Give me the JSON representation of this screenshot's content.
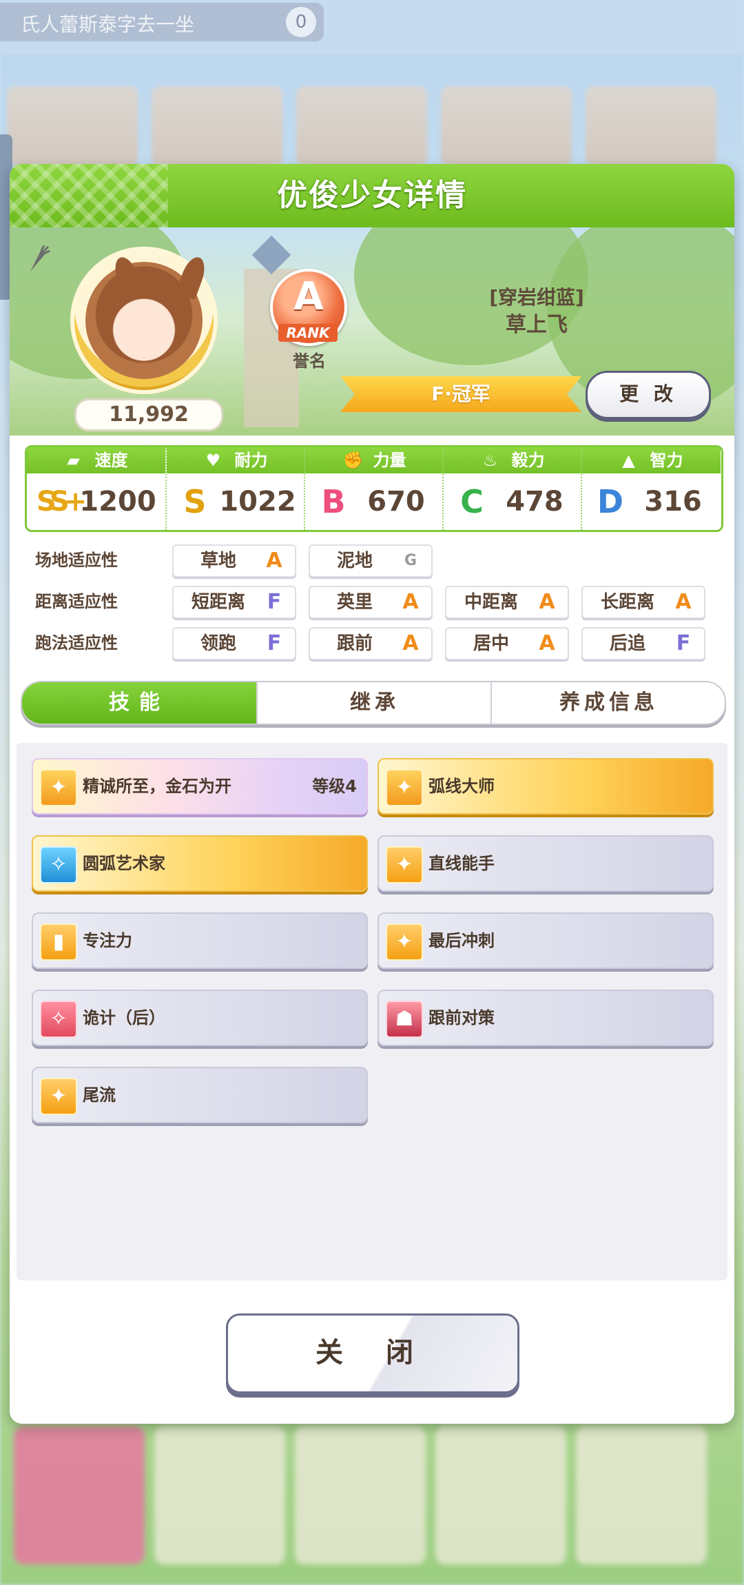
{
  "background": {
    "top_bar_text": "氏人蕾斯泰字去一坐",
    "top_bar_badge": "0"
  },
  "dialog": {
    "title": "优俊少女详情",
    "fans": "11,992",
    "rank": {
      "letter": "A",
      "ribbon": "RANK",
      "label": "誉名"
    },
    "epithet": "[穿岩绀蓝]",
    "name": "草上飞",
    "champion_title": "F·冠军",
    "change_button": "更 改"
  },
  "stats": [
    {
      "label": "速度",
      "icon": "shoe-icon",
      "grade": "SS+",
      "value": "1200"
    },
    {
      "label": "耐力",
      "icon": "heart-icon",
      "grade": "S",
      "value": "1022"
    },
    {
      "label": "力量",
      "icon": "muscle-icon",
      "grade": "B",
      "value": "670"
    },
    {
      "label": "毅力",
      "icon": "flame-icon",
      "grade": "C",
      "value": "478"
    },
    {
      "label": "智力",
      "icon": "graduation-cap-icon",
      "grade": "D",
      "value": "316"
    }
  ],
  "aptitude": {
    "track": {
      "label": "场地适应性",
      "items": [
        {
          "name": "草地",
          "grade": "A"
        },
        {
          "name": "泥地",
          "grade": "G"
        }
      ]
    },
    "distance": {
      "label": "距离适应性",
      "items": [
        {
          "name": "短距离",
          "grade": "F"
        },
        {
          "name": "英里",
          "grade": "A"
        },
        {
          "name": "中距离",
          "grade": "A"
        },
        {
          "name": "长距离",
          "grade": "A"
        }
      ]
    },
    "strategy": {
      "label": "跑法适应性",
      "items": [
        {
          "name": "领跑",
          "grade": "F"
        },
        {
          "name": "跟前",
          "grade": "A"
        },
        {
          "name": "居中",
          "grade": "A"
        },
        {
          "name": "后追",
          "grade": "F"
        }
      ]
    }
  },
  "tabs": [
    "技能",
    "继承",
    "养成信息"
  ],
  "skills": [
    {
      "name": "精诚所至，金石为开",
      "level": "等级4",
      "style": "rainbow",
      "icon": "runner-icon"
    },
    {
      "name": "弧线大师",
      "style": "gold",
      "icon": "runner-icon"
    },
    {
      "name": "圆弧艺术家",
      "style": "gold",
      "icon": "sparkle-icon"
    },
    {
      "name": "直线能手",
      "style": "normal",
      "icon": "runner-icon"
    },
    {
      "name": "专注力",
      "style": "normal",
      "icon": "gate-icon"
    },
    {
      "name": "最后冲刺",
      "style": "normal",
      "icon": "runner-icon"
    },
    {
      "name": "诡计（后）",
      "style": "normal",
      "icon": "sparkle-icon"
    },
    {
      "name": "跟前对策",
      "style": "normal",
      "icon": "devil-icon"
    },
    {
      "name": "尾流",
      "style": "normal",
      "icon": "runner-icon"
    }
  ],
  "close_button": "关 闭"
}
